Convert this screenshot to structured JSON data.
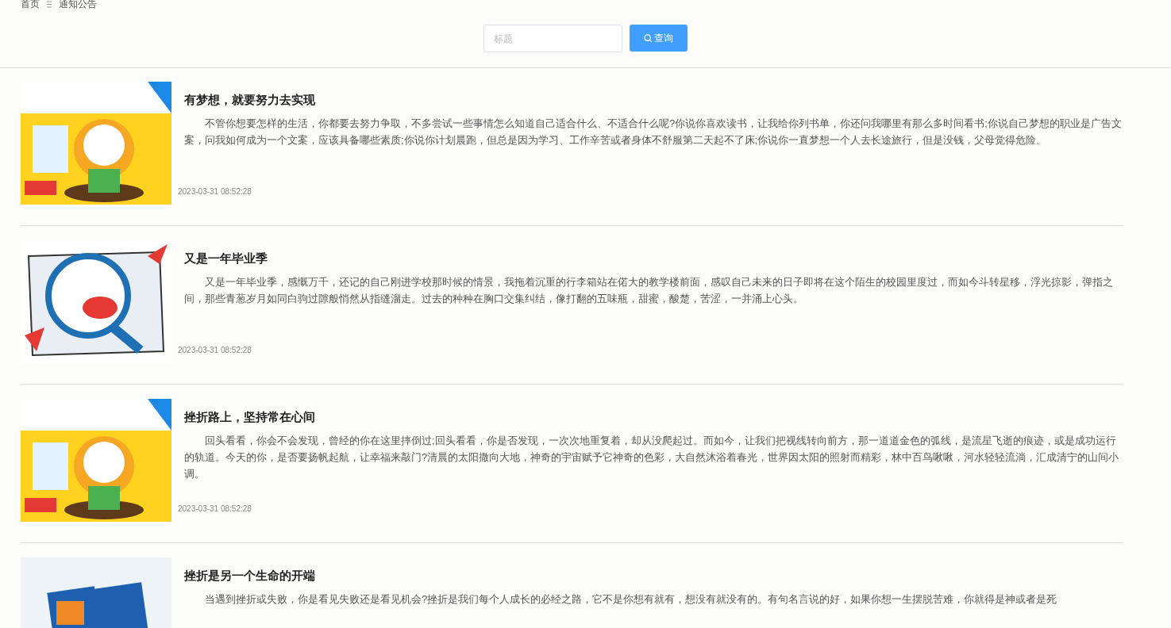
{
  "breadcrumb": [
    "首页",
    "通知公告"
  ],
  "search": {
    "placeholder": "标题",
    "button": "查询"
  },
  "notices": [
    {
      "title": "有梦想，就要努力去实现",
      "body": "不管你想要怎样的生活，你都要去努力争取，不多尝试一些事情怎么知道自己适合什么、不适合什么呢?你说你喜欢读书，让我给你列书单，你还问我哪里有那么多时间看书;你说自己梦想的职业是广告文案，问我如何成为一个文案，应该具备哪些素质;你说你计划晨跑，但总是因为学习、工作辛苦或者身体不舒服第二天起不了床;你说你一直梦想一个人去长途旅行，但是没钱，父母觉得危险。",
      "date": "2023-03-31 08:52:28"
    },
    {
      "title": "又是一年毕业季",
      "body": "又是一年毕业季，感慨万千，还记的自己刚进学校那时候的情景，我拖着沉重的行李箱站在偌大的教学楼前面，感叹自己未来的日子即将在这个陌生的校园里度过，而如今斗转星移，浮光掠影，弹指之间，那些青葱岁月如同白驹过隙般悄然从指缝溜走。过去的种种在胸口交集纠结，像打翻的五味瓶，甜蜜，酸楚，苦涩，一并涌上心头。",
      "date": "2023-03-31 08:52:28"
    },
    {
      "title": "挫折路上，坚持常在心间",
      "body": "回头看看，你会不会发现，曾经的你在这里摔倒过;回头看看，你是否发现，一次次地重复着，却从没爬起过。而如今，让我们把视线转向前方，那一道道金色的弧线，是流星飞逝的痕迹，或是成功运行的轨道。今天的你，是否要扬帆起航，让幸福来敲门?清晨的太阳撒向大地，神奇的宇宙赋予它神奇的色彩，大自然沐浴着春光，世界因太阳的照射而精彩，林中百鸟啾啾，河水轻轻流淌，汇成清宁的山间小调。",
      "date": "2023-03-31 08:52:28"
    },
    {
      "title": "挫折是另一个生命的开端",
      "body": "当遇到挫折或失败，你是看见失败还是看见机会?挫折是我们每个人成长的必经之路，它不是你想有就有，想没有就没有的。有句名言说的好，如果你想一生摆脱苦难，你就得是神或者是死"
    }
  ]
}
